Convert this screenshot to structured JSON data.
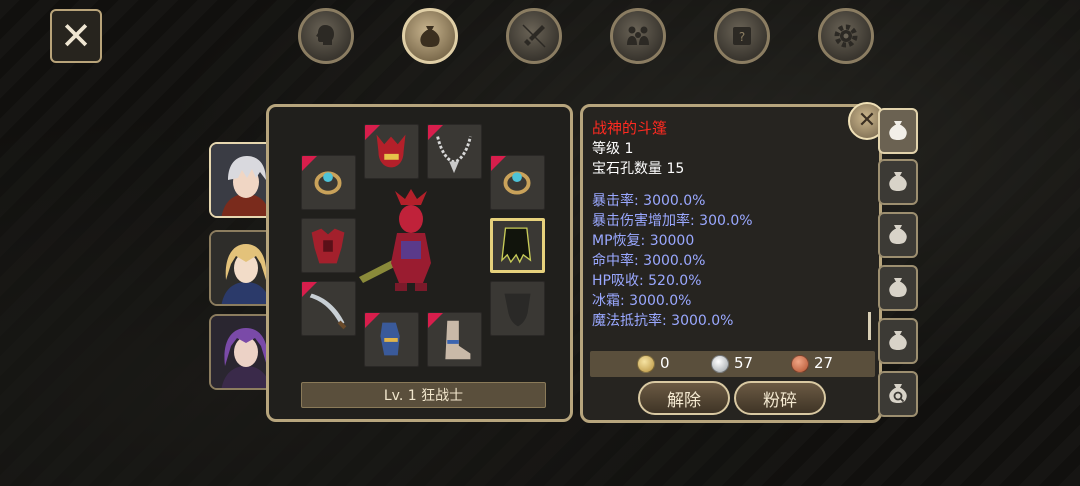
{
  "nav": {
    "close_icon": "close-icon",
    "tabs": [
      {
        "icon": "character-head-icon",
        "active": false
      },
      {
        "icon": "bag-icon",
        "active": true
      },
      {
        "icon": "skill-sword-icon",
        "active": false
      },
      {
        "icon": "party-icon",
        "active": false
      },
      {
        "icon": "quest-scroll-icon",
        "active": false
      },
      {
        "icon": "settings-gear-icon",
        "active": false
      }
    ]
  },
  "characters": [
    {
      "hair": "#d9d9de",
      "accent": "#7a2b1c",
      "active": true
    },
    {
      "hair": "#e3c27a",
      "accent": "#2b3a6a",
      "active": false
    },
    {
      "hair": "#7a4aa8",
      "accent": "#3a2a4a",
      "active": false
    }
  ],
  "equipment": {
    "level_label": "Lv. 1 狂战士",
    "slots": [
      {
        "icon": "ring-icon",
        "tagged": true,
        "selected": false
      },
      {
        "icon": "dragon-helm-icon",
        "tagged": true,
        "selected": false
      },
      {
        "icon": "necklace-icon",
        "tagged": true,
        "selected": false
      },
      {
        "icon": "ring-icon",
        "tagged": true,
        "selected": false
      },
      {
        "icon": "armor-icon",
        "tagged": false,
        "selected": false
      },
      {
        "icon": "cloak-icon",
        "tagged": false,
        "selected": true
      },
      {
        "icon": "sword-icon",
        "tagged": true,
        "selected": false
      },
      {
        "icon": "shield-empty-icon",
        "tagged": false,
        "selected": false
      },
      {
        "icon": "gauntlet-icon",
        "tagged": true,
        "selected": false
      },
      {
        "icon": "boots-icon",
        "tagged": true,
        "selected": false
      }
    ]
  },
  "item": {
    "name": "战神的斗篷",
    "level": "等级 1",
    "gem_slots": "宝石孔数量 15",
    "stats": [
      "暴击率: 3000.0%",
      "暴击伤害增加率: 300.0%",
      "MP恢复: 30000",
      "命中率: 3000.0%",
      "HP吸收: 520.0%",
      "冰霜: 3000.0%",
      "魔法抵抗率: 3000.0%"
    ]
  },
  "currency": {
    "gold": "0",
    "silver": "57",
    "copper": "27"
  },
  "actions": {
    "unequip": "解除",
    "crush": "粉碎"
  },
  "colors": {
    "item_name": "#ff2a20",
    "stat_text": "#9aa8ff",
    "panel_border": "#b7a57d",
    "tag": "#d81e4c"
  },
  "bag_tabs": [
    {
      "icon": "bag-icon",
      "active": true
    },
    {
      "icon": "bag-icon",
      "active": false
    },
    {
      "icon": "bag-icon",
      "active": false
    },
    {
      "icon": "bag-icon",
      "active": false
    },
    {
      "icon": "bag-icon",
      "active": false
    },
    {
      "icon": "bag-search-icon",
      "active": false
    }
  ]
}
